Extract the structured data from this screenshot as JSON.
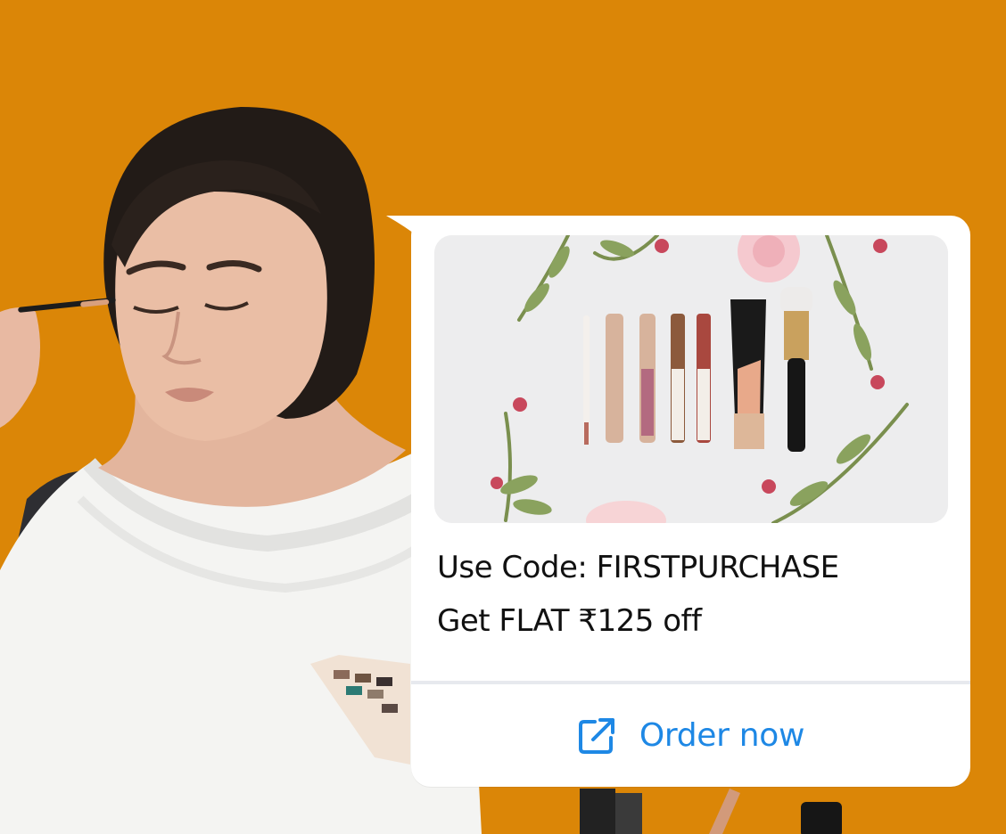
{
  "message": {
    "code_line": "Use Code: FIRSTPURCHASE",
    "offer_line": "Get FLAT ₹125 off"
  },
  "action": {
    "label": "Order now",
    "icon": "open-external-icon"
  },
  "colors": {
    "background": "#DB8607",
    "card": "#FFFFFF",
    "accent": "#1E88E5",
    "text": "#111111"
  }
}
